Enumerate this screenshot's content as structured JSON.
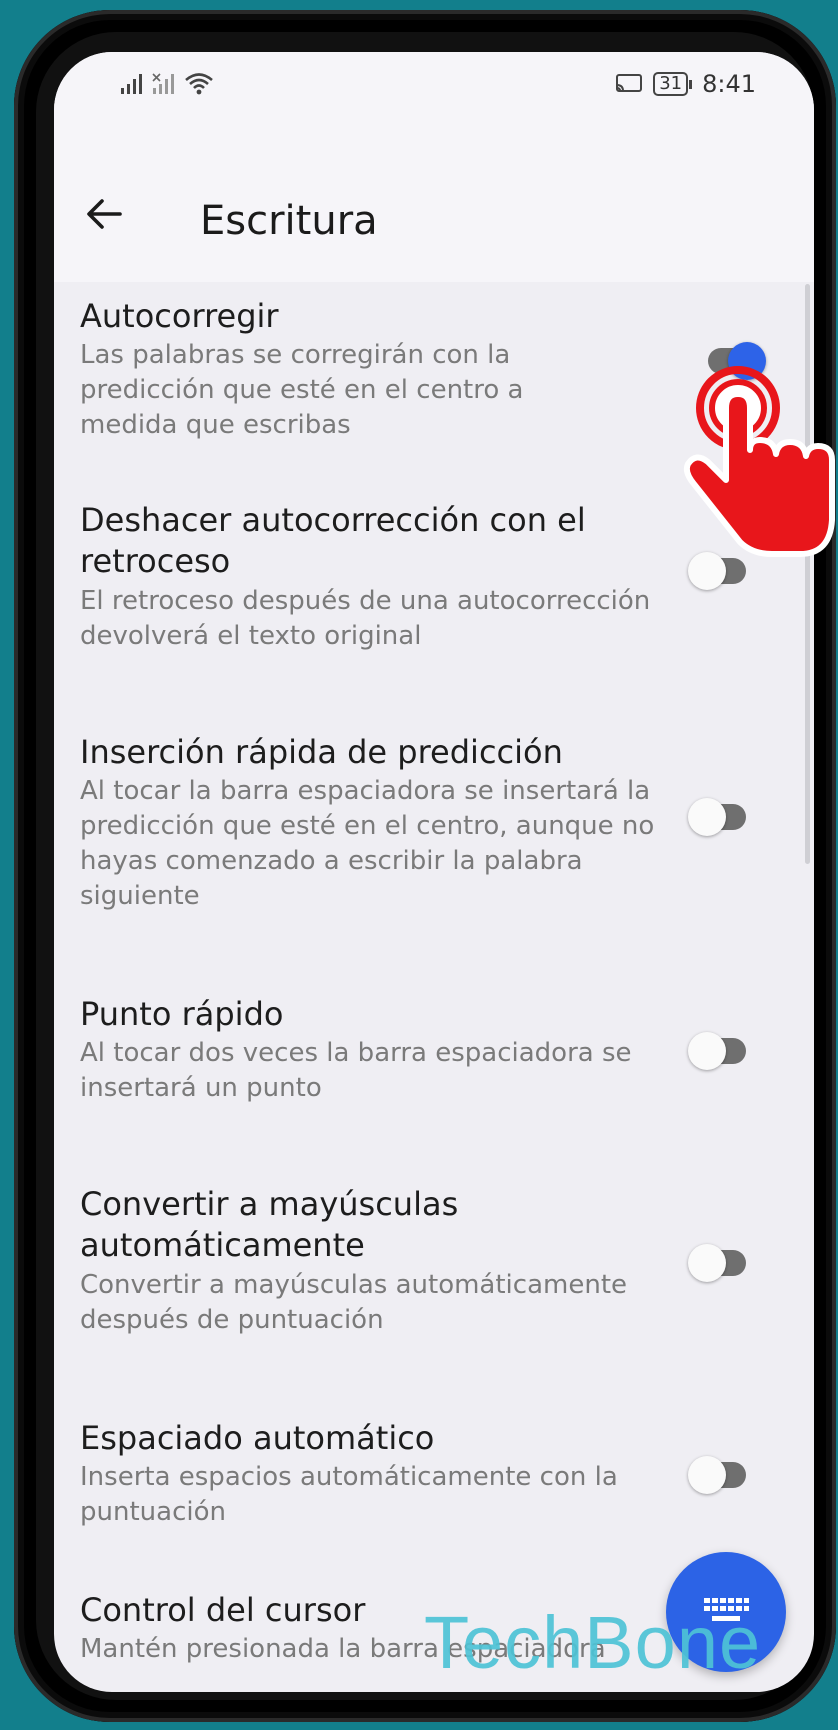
{
  "status_bar": {
    "time": "8:41",
    "battery": "31",
    "icons": [
      "signal-icon",
      "signal-no-sim-icon",
      "wifi-icon",
      "cast-icon",
      "battery-icon"
    ]
  },
  "header": {
    "title": "Escritura",
    "back_icon": "back-arrow-icon"
  },
  "settings": [
    {
      "title": "Autocorregir",
      "description": "Las palabras se corregirán con la predicción que esté en el centro a medida que escribas",
      "enabled": true
    },
    {
      "title": "Deshacer autocorrección con el retroceso",
      "description": "El retroceso después de una autocorrección devolverá el texto original",
      "enabled": false
    },
    {
      "title": "Inserción rápida de predicción",
      "description": "Al tocar la barra espaciadora se insertará la predicción que esté en el centro, aunque no hayas comenzado a escribir la palabra siguiente",
      "enabled": false
    },
    {
      "title": "Punto rápido",
      "description": "Al tocar dos veces la barra espaciadora se insertará un punto",
      "enabled": false
    },
    {
      "title": "Convertir a mayúsculas automáticamente",
      "description": "Convertir a mayúsculas automáticamente después de puntuación",
      "enabled": false
    },
    {
      "title": "Espaciado automático",
      "description": "Inserta espacios automáticamente con la puntuación",
      "enabled": false
    },
    {
      "title": "Control del cursor",
      "description": "Mantén presionada la barra espaciadora",
      "enabled": false
    }
  ],
  "fab": {
    "icon": "keyboard-icon"
  },
  "watermark": "TechBone",
  "colors": {
    "accent": "#2d63e8",
    "background": "#127f8c",
    "tap_indicator": "#e8161b"
  }
}
